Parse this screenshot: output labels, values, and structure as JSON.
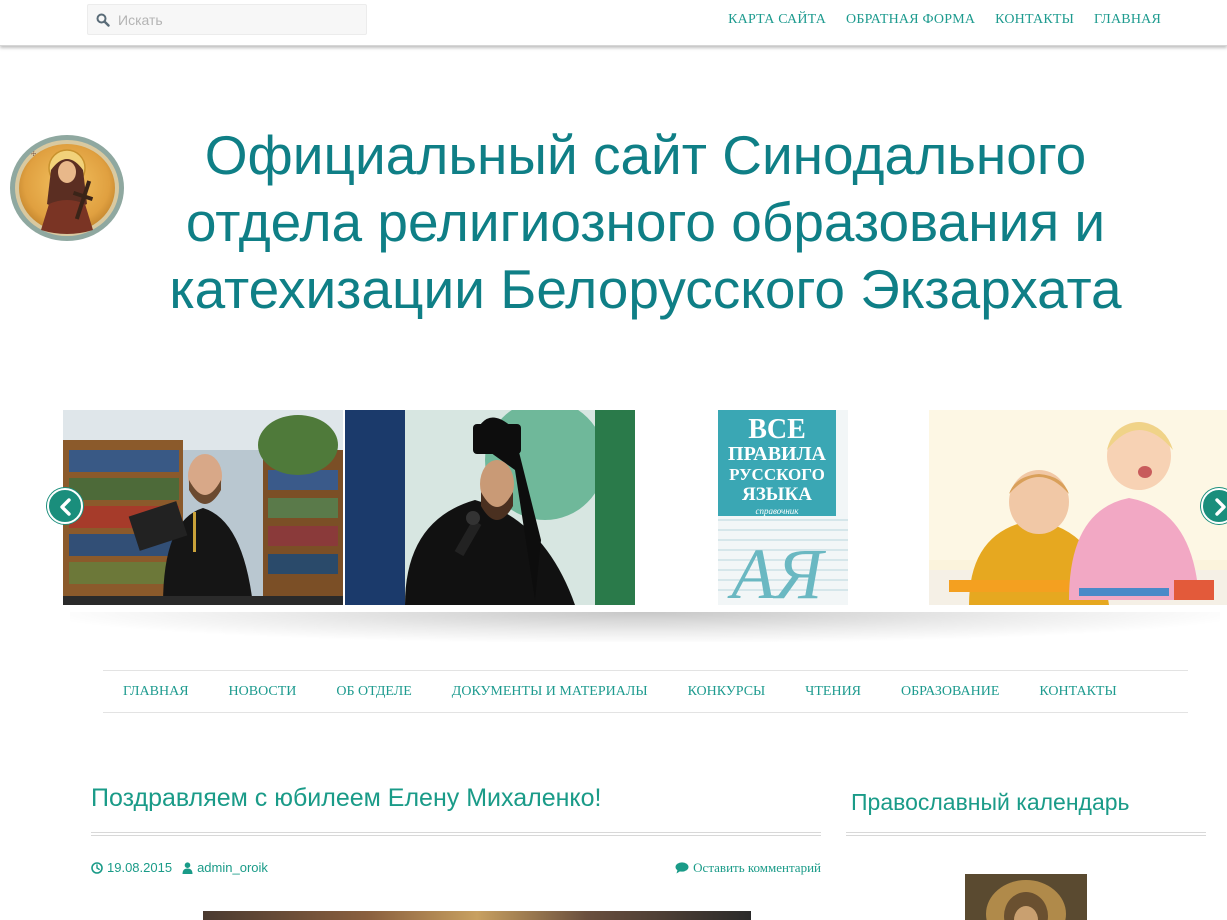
{
  "search": {
    "placeholder": "Искать",
    "value": ""
  },
  "top_nav": [
    {
      "label": "КАРТА САЙТА"
    },
    {
      "label": "ОБРАТНАЯ ФОРМА"
    },
    {
      "label": "КОНТАКТЫ"
    },
    {
      "label": "ГЛАВНАЯ"
    }
  ],
  "site_title": "Официальный сайт Синодального отдела религиозного образования и катехизации Белорусского Экзархата",
  "slider": {
    "book_cover": {
      "line1": "ВСЕ",
      "line2": "ПРАВИЛА",
      "line3": "РУССКОГО",
      "line4": "ЯЗЫКА",
      "line5": "справочник",
      "letters": "АЯ"
    }
  },
  "main_nav": [
    {
      "label": "ГЛАВНАЯ"
    },
    {
      "label": "НОВОСТИ"
    },
    {
      "label": "ОБ ОТДЕЛЕ"
    },
    {
      "label": "ДОКУМЕНТЫ И МАТЕРИАЛЫ"
    },
    {
      "label": "КОНКУРСЫ"
    },
    {
      "label": "ЧТЕНИЯ"
    },
    {
      "label": "ОБРАЗОВАНИЕ"
    },
    {
      "label": "КОНТАКТЫ"
    }
  ],
  "post": {
    "title": "Поздравляем с юбилеем Елену Михаленко!",
    "date": "19.08.2015",
    "author": "admin_oroik",
    "comment_link": "Оставить комментарий"
  },
  "sidebar": {
    "title": "Православный календарь"
  },
  "colors": {
    "accent": "#1a9b88",
    "title": "#0f7f86",
    "arrow": "#1a8e7c"
  }
}
